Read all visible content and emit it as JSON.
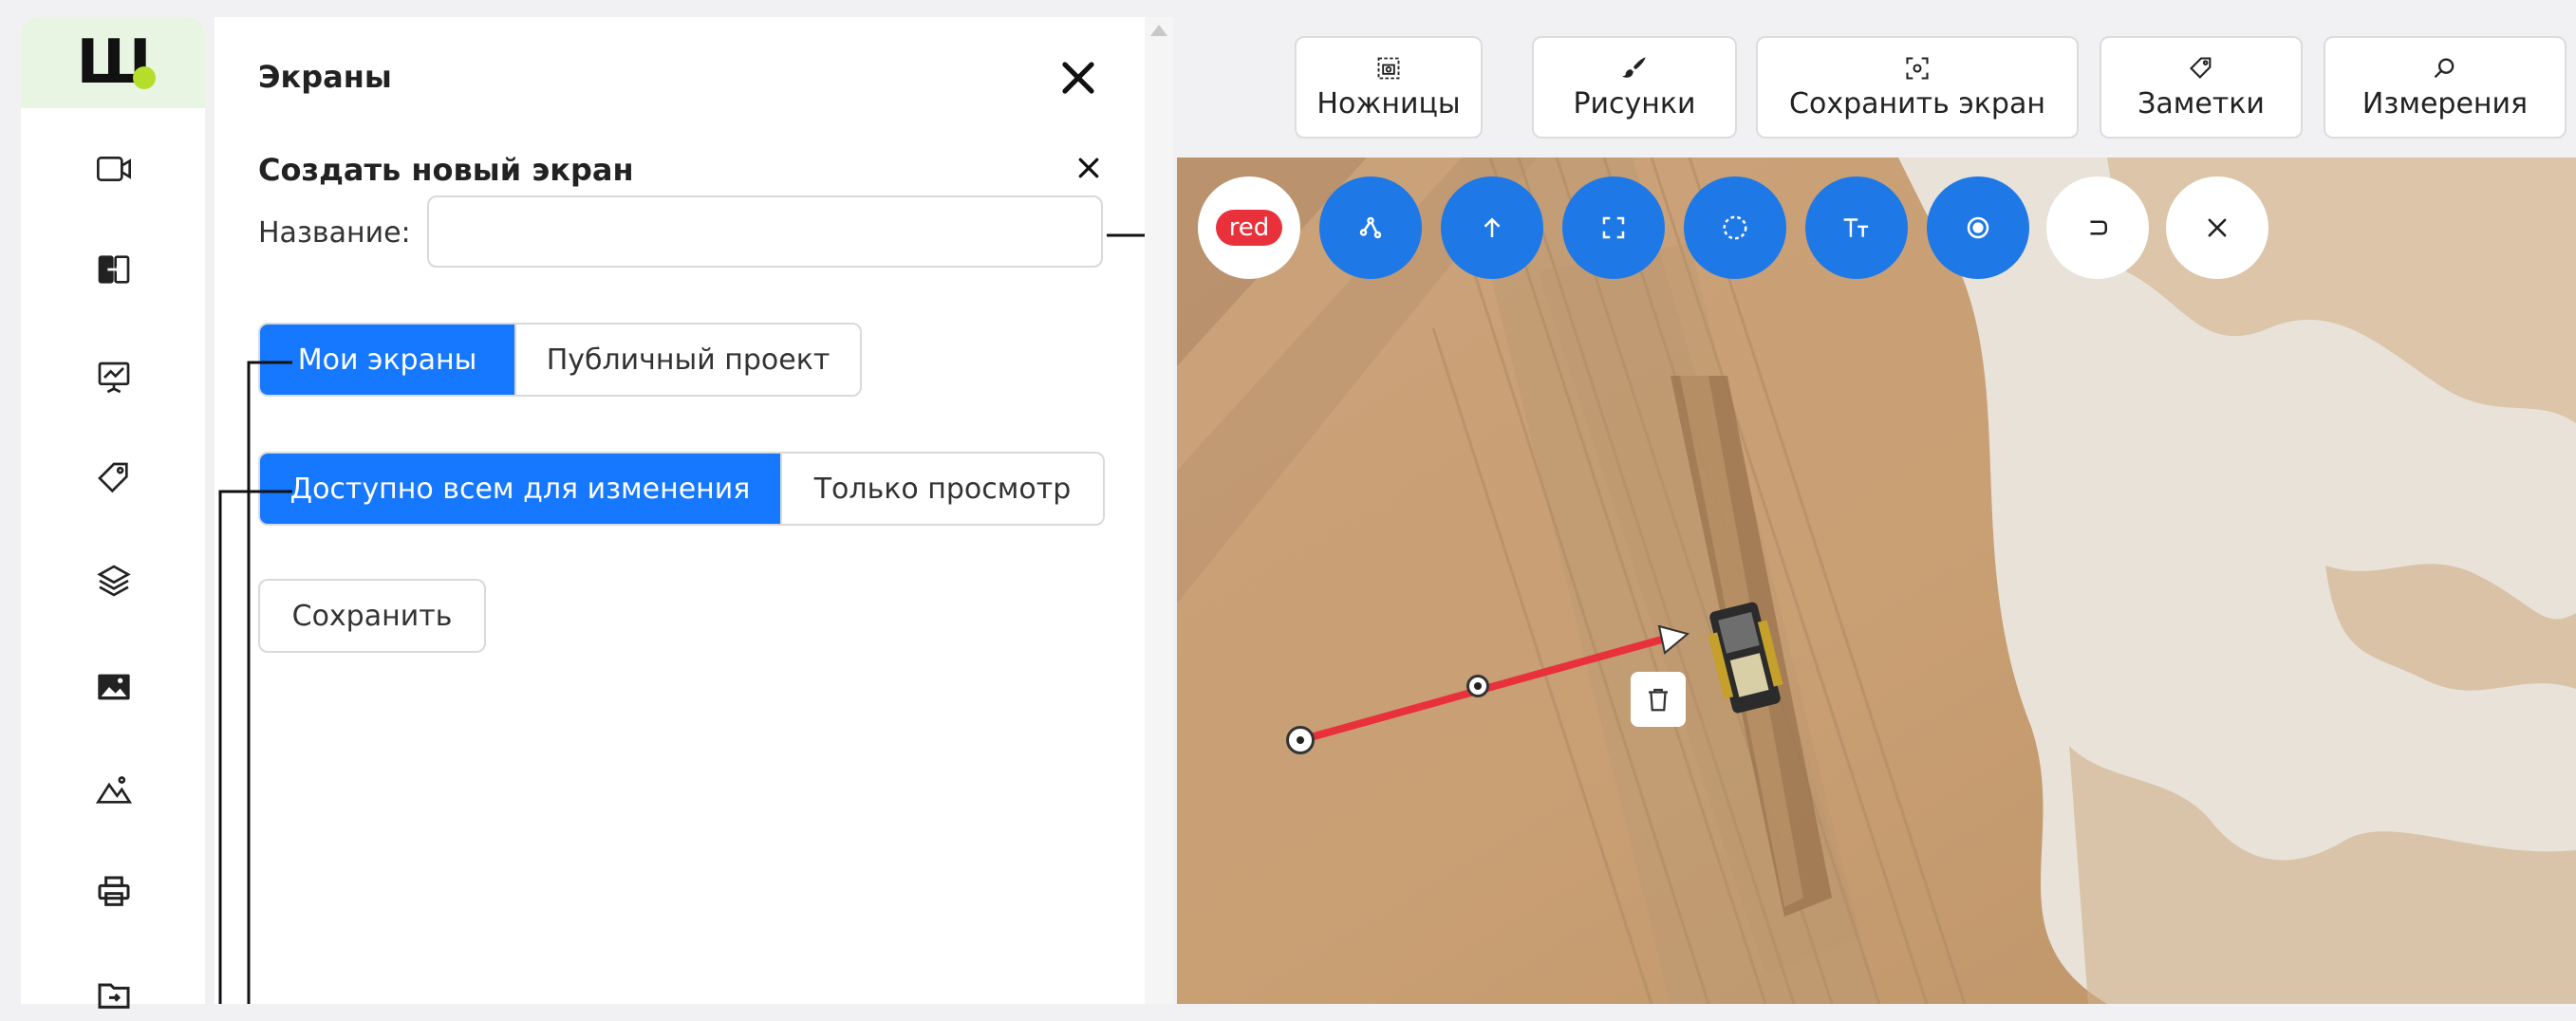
{
  "logo": {
    "text": "Ш"
  },
  "rail": {
    "items": [
      {
        "icon": "video-camera-icon"
      },
      {
        "icon": "compare-icon"
      },
      {
        "icon": "presentation-chart-icon"
      },
      {
        "icon": "tag-icon"
      },
      {
        "icon": "layers-icon"
      },
      {
        "icon": "image-icon"
      },
      {
        "icon": "terrain-icon"
      },
      {
        "icon": "printer-icon"
      },
      {
        "icon": "folder-import-icon"
      }
    ]
  },
  "panel": {
    "title": "Экраны",
    "create": {
      "title": "Создать новый экран",
      "name_label": "Название",
      "name_colon": ":",
      "name_value": "",
      "scope_options": [
        "Мои экраны",
        "Публичный проект"
      ],
      "scope_selected": "Мои экраны",
      "access_options": [
        "Доступно всем для изменения",
        "Только просмотр"
      ],
      "access_selected": "Доступно всем для изменения",
      "save_label": "Сохранить"
    }
  },
  "toolbar": {
    "scissors": "Ножницы",
    "drawings": "Рисунки",
    "save_screen": "Сохранить экран",
    "notes": "Заметки",
    "measurements": "Измерения"
  },
  "draw_tools": {
    "color_label": "red",
    "color_value": "#e8313b",
    "accent": "#1e78e6",
    "items": [
      "polyline-tool-icon",
      "arrow-tool-icon",
      "rectangle-tool-icon",
      "circle-tool-icon",
      "text-tool-icon",
      "point-tool-icon",
      "undo-icon",
      "close-icon"
    ]
  },
  "colors": {
    "primary": "#1677ff",
    "brand_green": "#b5dd2c",
    "line_red": "#e8313b"
  }
}
